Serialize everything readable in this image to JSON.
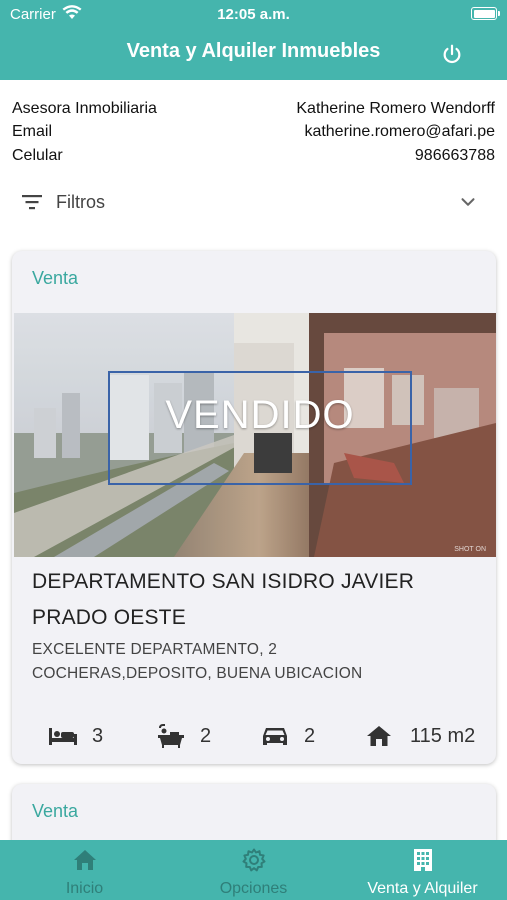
{
  "status_bar": {
    "carrier": "Carrier",
    "time": "12:05 a.m."
  },
  "header": {
    "title": "Venta y Alquiler Inmuebles",
    "power_icon": "power-icon"
  },
  "agent": {
    "role_label": "Asesora Inmobiliaria",
    "role_value": "Katherine Romero Wendorff",
    "email_label": "Email",
    "email_value": "katherine.romero@afari.pe",
    "phone_label": "Celular",
    "phone_value": "986663788"
  },
  "filters": {
    "label": "Filtros"
  },
  "listings": [
    {
      "type": "Venta",
      "overlay": "VENDIDO",
      "watermark": "SHOT ON",
      "title": "DEPARTAMENTO SAN ISIDRO JAVIER PRADO OESTE",
      "description": "EXCELENTE DEPARTAMENTO, 2 COCHERAS,DEPOSITO, BUENA UBICACION",
      "bedrooms": "3",
      "bathrooms": "2",
      "parking": "2",
      "area": "115 m2"
    },
    {
      "type": "Venta"
    }
  ],
  "tabs": [
    {
      "label": "Inicio",
      "icon": "home-icon",
      "active": false
    },
    {
      "label": "Opciones",
      "icon": "gear-icon",
      "active": false
    },
    {
      "label": "Venta y Alquiler",
      "icon": "building-icon",
      "active": true
    }
  ],
  "colors": {
    "primary": "#45b5ad",
    "accent_text": "#3aa89f",
    "sold_border": "#3a63a8"
  }
}
